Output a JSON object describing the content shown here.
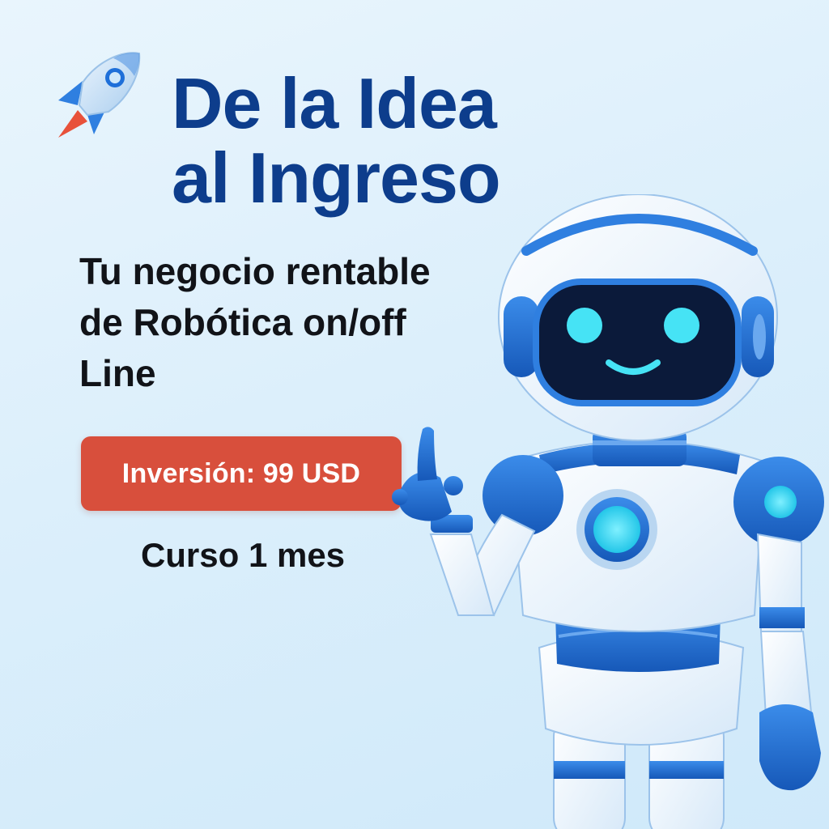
{
  "poster": {
    "title_line1": "De la Idea",
    "title_line2": "al Ingreso",
    "subtitle_line1": "Tu negocio rentable",
    "subtitle_line2": "de Robótica on/off",
    "subtitle_line3": "Line",
    "price_label": "Inversión: 99 USD",
    "duration": "Curso 1 mes"
  },
  "icons": {
    "rocket": "rocket-icon",
    "robot": "robot-mascot"
  },
  "colors": {
    "title": "#0d3d8c",
    "badge": "#d84f3c",
    "robot_blue": "#1e6fd9",
    "robot_eye": "#46e3f5"
  }
}
